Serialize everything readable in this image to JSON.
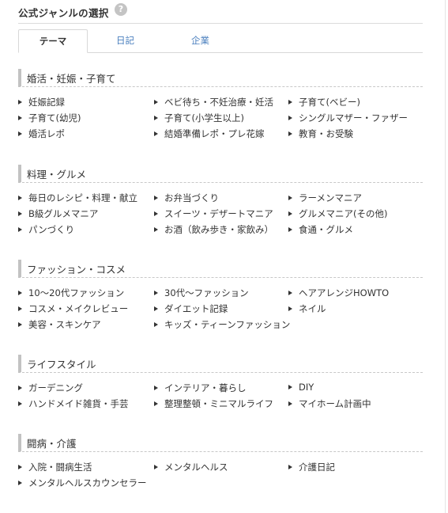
{
  "header": {
    "title": "公式ジャンルの選択",
    "help_icon": "?"
  },
  "tabs": [
    {
      "label": "テーマ",
      "active": true
    },
    {
      "label": "日記",
      "active": false
    },
    {
      "label": "企業",
      "active": false
    }
  ],
  "sections": [
    {
      "title": "婚活・妊娠・子育て",
      "items": [
        "妊娠記録",
        "ベビ待ち・不妊治療・妊活",
        "子育て(ベビー)",
        "子育て(幼児)",
        "子育て(小学生以上)",
        "シングルマザー・ファザー",
        "婚活レポ",
        "結婚準備レポ・プレ花嫁",
        "教育・お受験"
      ]
    },
    {
      "title": "料理・グルメ",
      "items": [
        "毎日のレシピ・料理・献立",
        "お弁当づくり",
        "ラーメンマニア",
        "B級グルメマニア",
        "スイーツ・デザートマニア",
        "グルメマニア(その他)",
        "パンづくり",
        "お酒（飲み歩き・家飲み）",
        "食通・グルメ"
      ]
    },
    {
      "title": "ファッション・コスメ",
      "items": [
        "10～20代ファッション",
        "30代～ファッション",
        "ヘアアレンジHOWTO",
        "コスメ・メイクレビュー",
        "ダイエット記録",
        "ネイル",
        "美容・スキンケア",
        "キッズ・ティーンファッション"
      ]
    },
    {
      "title": "ライフスタイル",
      "items": [
        "ガーデニング",
        "インテリア・暮らし",
        "DIY",
        "ハンドメイド雑貨・手芸",
        "整理整頓・ミニマルライフ",
        "マイホーム計画中"
      ]
    },
    {
      "title": "闘病・介護",
      "items": [
        "入院・闘病生活",
        "メンタルヘルス",
        "介護日記",
        "メンタルヘルスカウンセラー"
      ]
    }
  ]
}
